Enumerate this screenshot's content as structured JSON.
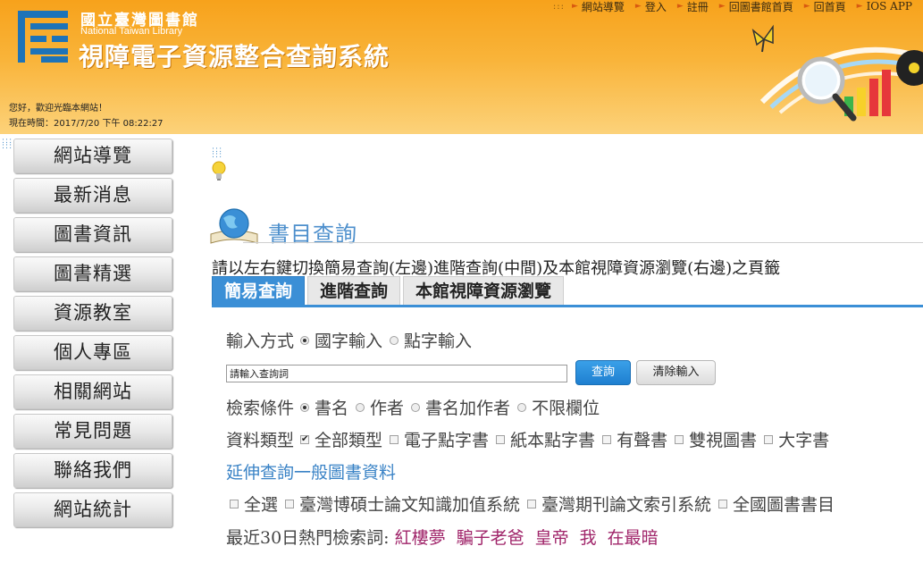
{
  "header": {
    "logo_zh": "國立臺灣圖書館",
    "logo_en": "National Taiwan Library",
    "site_title": "視障電子資源整合查詢系統",
    "welcome": "您好，歡迎光臨本網站！",
    "time_label": "現在時間：",
    "time_value": "2017/7/20 下午 08:22:27",
    "top_nav": [
      "網站導覽",
      "登入",
      "註冊",
      "回圖書館首頁",
      "回首頁",
      "IOS APP"
    ]
  },
  "sidebar": {
    "items": [
      "網站導覽",
      "最新消息",
      "圖書資訊",
      "圖書精選",
      "資源教室",
      "個人專區",
      "相關網站",
      "常見問題",
      "聯絡我們",
      "網站統計"
    ]
  },
  "main": {
    "section_title": "書目查詢",
    "instructions": "請以左右鍵切換簡易查詢(左邊)進階查詢(中間)及本館視障資源瀏覽(右邊)之頁籤",
    "tabs": [
      "簡易查詢",
      "進階查詢",
      "本館視障資源瀏覽"
    ],
    "active_tab": "簡易查詢",
    "input_method": {
      "label": "輸入方式",
      "options": [
        "國字輸入",
        "點字輸入"
      ],
      "selected": "國字輸入"
    },
    "search": {
      "value": "請輸入查詢詞",
      "submit_label": "查詢",
      "clear_label": "清除輸入"
    },
    "search_condition": {
      "label": "檢索條件",
      "options": [
        "書名",
        "作者",
        "書名加作者",
        "不限欄位"
      ],
      "selected": "書名"
    },
    "material_type": {
      "label": "資料類型",
      "options": [
        "全部類型",
        "電子點字書",
        "紙本點字書",
        "有聲書",
        "雙視圖書",
        "大字書"
      ],
      "checked": [
        "全部類型"
      ]
    },
    "extend_link": "延伸查詢一般圖書資料",
    "databases": {
      "options": [
        "全選",
        "臺灣博碩士論文知識加值系統",
        "臺灣期刊論文索引系統",
        "全國圖書書目"
      ]
    },
    "hot_keywords": {
      "label": "最近30日熱門檢索詞:",
      "terms": [
        "紅樓夢",
        "騙子老爸",
        "皇帝",
        "我",
        "在最暗"
      ]
    }
  },
  "colors": {
    "header_orange": "#f7a21b",
    "tab_active": "#3b8fd6",
    "title_blue": "#4d8fcc",
    "hot_term": "#a0256a"
  }
}
